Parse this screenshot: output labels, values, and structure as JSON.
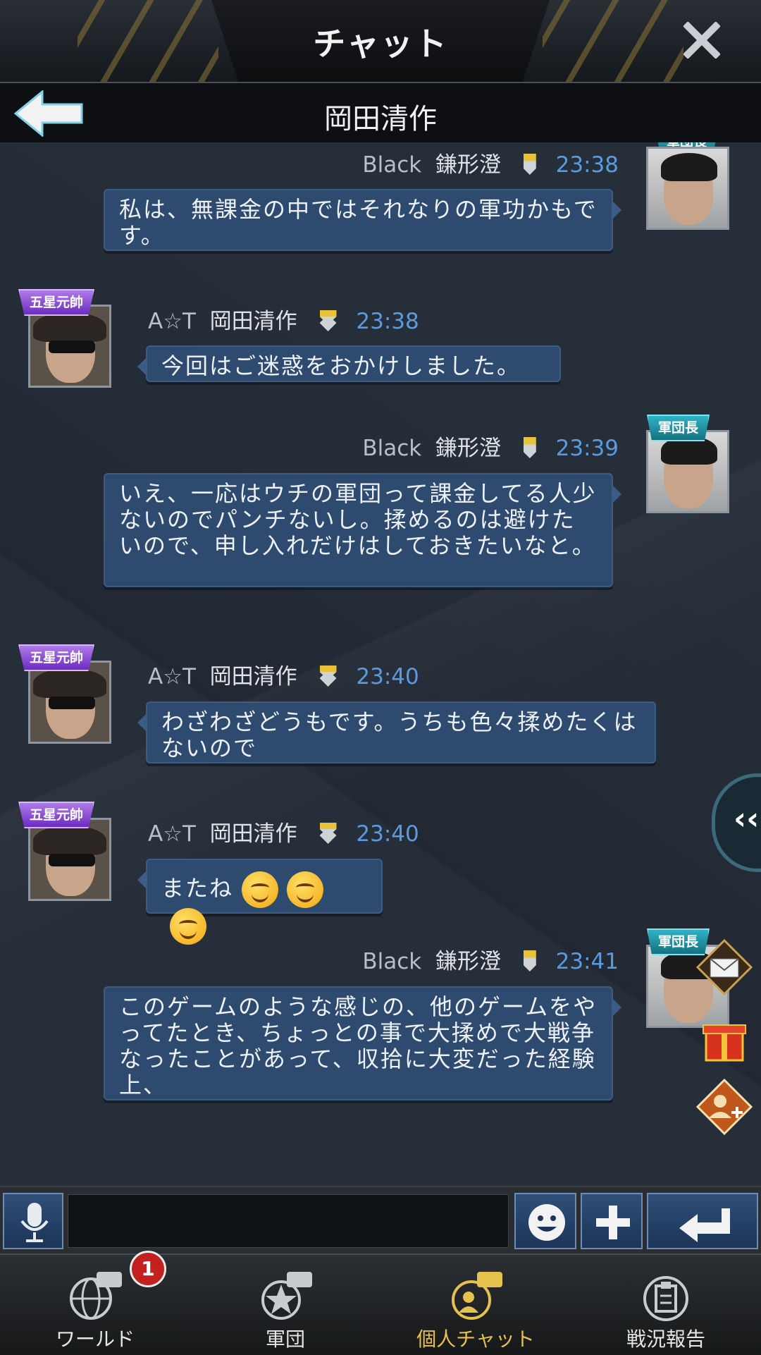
{
  "header": {
    "title": "チャット",
    "subtitle": "岡田清作"
  },
  "messages": [
    {
      "side": "right",
      "alliance": "Black",
      "name": "鎌形澄",
      "time": "23:38",
      "rank": "軍団長",
      "text": "私は、無課金の中ではそれなりの軍功かもです。"
    },
    {
      "side": "left",
      "alliance": "A☆T",
      "name": "岡田清作",
      "time": "23:38",
      "rank": "五星元帥",
      "text": "今回はご迷惑をおかけしました。"
    },
    {
      "side": "right",
      "alliance": "Black",
      "name": "鎌形澄",
      "time": "23:39",
      "rank": "軍団長",
      "text": "いえ、一応はウチの軍団って課金してる人少ないのでパンチないし。揉めるのは避けたいので、申し入れだけはしておきたいなと。"
    },
    {
      "side": "left",
      "alliance": "A☆T",
      "name": "岡田清作",
      "time": "23:40",
      "rank": "五星元帥",
      "text": "わざわざどうもです。うちも色々揉めたくはないので"
    },
    {
      "side": "left",
      "alliance": "A☆T",
      "name": "岡田清作",
      "time": "23:40",
      "rank": "五星元帥",
      "text": "またね"
    },
    {
      "side": "right",
      "alliance": "Black",
      "name": "鎌形澄",
      "time": "23:41",
      "rank": "軍団長",
      "text": "このゲームのような感じの、他のゲームをやってたとき、ちょっとの事で大揉めで大戦争なったことがあって、収拾に大変だった経験上、"
    }
  ],
  "side_panel": {
    "gift_label": "祝儀"
  },
  "nav": {
    "world": "ワールド",
    "world_badge": "1",
    "legion": "軍団",
    "private": "個人チャット",
    "report": "戦況報告"
  },
  "colors": {
    "accent": "#e6c14e",
    "time": "#5a9be0",
    "bubble": "#2e4a6e"
  }
}
